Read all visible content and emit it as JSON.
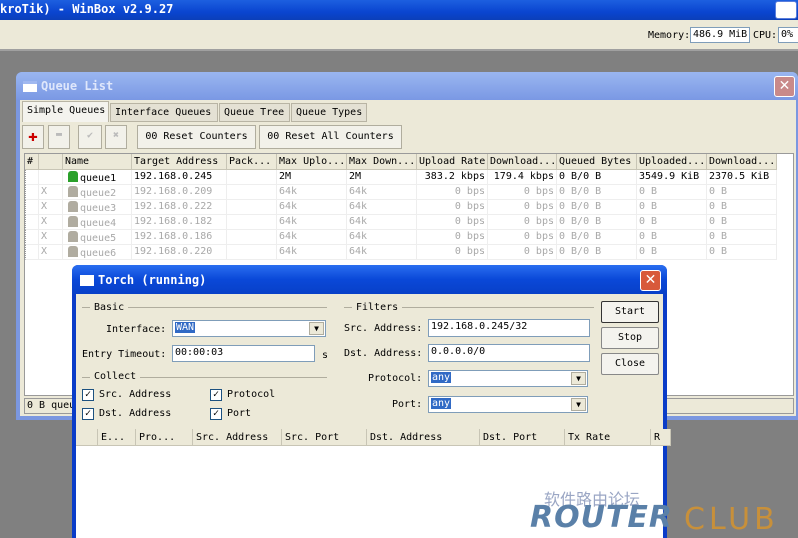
{
  "app": {
    "title": "kroTik) - WinBox v2.9.27",
    "memory_label": "Memory:",
    "memory_value": "486.9 MiB",
    "cpu_label": "CPU:",
    "cpu_value": "0%"
  },
  "queue_list": {
    "title": "Queue List",
    "tabs": [
      {
        "label": "Simple Queues",
        "active": true
      },
      {
        "label": "Interface Queues"
      },
      {
        "label": "Queue Tree"
      },
      {
        "label": "Queue Types"
      }
    ],
    "toolbar": {
      "add_icon": "plus-icon",
      "remove_icon": "minus-icon",
      "enable_icon": "check-icon",
      "disable_icon": "x-icon",
      "reset_counters": "00 Reset Counters",
      "reset_all_counters": "00 Reset All Counters"
    },
    "columns": [
      "#",
      "",
      "Name",
      "Target Address",
      "Pack...",
      "Max Uplo...",
      "Max Down...",
      "Upload Rate",
      "Download...",
      "Queued Bytes",
      "Uploaded...",
      "Download..."
    ],
    "rows": [
      {
        "flag": "",
        "name": "queue1",
        "target": "192.168.0.245",
        "pack": "",
        "max_up": "2M",
        "max_down": "2M",
        "up_rate": "383.2 kbps",
        "down_rate": "179.4 kbps",
        "queued": "0 B/0 B",
        "uploaded": "3549.9 KiB",
        "downloaded": "2370.5 KiB",
        "disabled": false
      },
      {
        "flag": "X",
        "name": "queue2",
        "target": "192.168.0.209",
        "pack": "",
        "max_up": "64k",
        "max_down": "64k",
        "up_rate": "0 bps",
        "down_rate": "0 bps",
        "queued": "0 B/0 B",
        "uploaded": "0 B",
        "downloaded": "0 B",
        "disabled": true
      },
      {
        "flag": "X",
        "name": "queue3",
        "target": "192.168.0.222",
        "pack": "",
        "max_up": "64k",
        "max_down": "64k",
        "up_rate": "0 bps",
        "down_rate": "0 bps",
        "queued": "0 B/0 B",
        "uploaded": "0 B",
        "downloaded": "0 B",
        "disabled": true
      },
      {
        "flag": "X",
        "name": "queue4",
        "target": "192.168.0.182",
        "pack": "",
        "max_up": "64k",
        "max_down": "64k",
        "up_rate": "0 bps",
        "down_rate": "0 bps",
        "queued": "0 B/0 B",
        "uploaded": "0 B",
        "downloaded": "0 B",
        "disabled": true
      },
      {
        "flag": "X",
        "name": "queue5",
        "target": "192.168.0.186",
        "pack": "",
        "max_up": "64k",
        "max_down": "64k",
        "up_rate": "0 bps",
        "down_rate": "0 bps",
        "queued": "0 B/0 B",
        "uploaded": "0 B",
        "downloaded": "0 B",
        "disabled": true
      },
      {
        "flag": "X",
        "name": "queue6",
        "target": "192.168.0.220",
        "pack": "",
        "max_up": "64k",
        "max_down": "64k",
        "up_rate": "0 bps",
        "down_rate": "0 bps",
        "queued": "0 B/0 B",
        "uploaded": "0 B",
        "downloaded": "0 B",
        "disabled": true
      }
    ],
    "status": "0 B queu"
  },
  "torch": {
    "title": "Torch (running)",
    "basic_label": "Basic",
    "interface_label": "Interface:",
    "interface_value": "WAN",
    "timeout_label": "Entry Timeout:",
    "timeout_value": "00:00:03",
    "timeout_unit": "s",
    "collect_label": "Collect",
    "collect": [
      {
        "label": "Src. Address",
        "checked": true
      },
      {
        "label": "Protocol",
        "checked": true
      },
      {
        "label": "Dst. Address",
        "checked": true
      },
      {
        "label": "Port",
        "checked": true
      }
    ],
    "filters_label": "Filters",
    "src_label": "Src. Address:",
    "src_value": "192.168.0.245/32",
    "dst_label": "Dst. Address:",
    "dst_value": "0.0.0.0/0",
    "protocol_label": "Protocol:",
    "protocol_value": "any",
    "port_label": "Port:",
    "port_value": "any",
    "buttons": {
      "start": "Start",
      "stop": "Stop",
      "close": "Close"
    },
    "columns": [
      "",
      "E...",
      "Pro...",
      "Src. Address",
      "Src. Port",
      "Dst. Address",
      "Dst. Port",
      "Tx Rate",
      "R"
    ]
  },
  "watermark": {
    "cn": "软件路由论坛",
    "en1": "ROUTER",
    "en2": "CLUB"
  }
}
